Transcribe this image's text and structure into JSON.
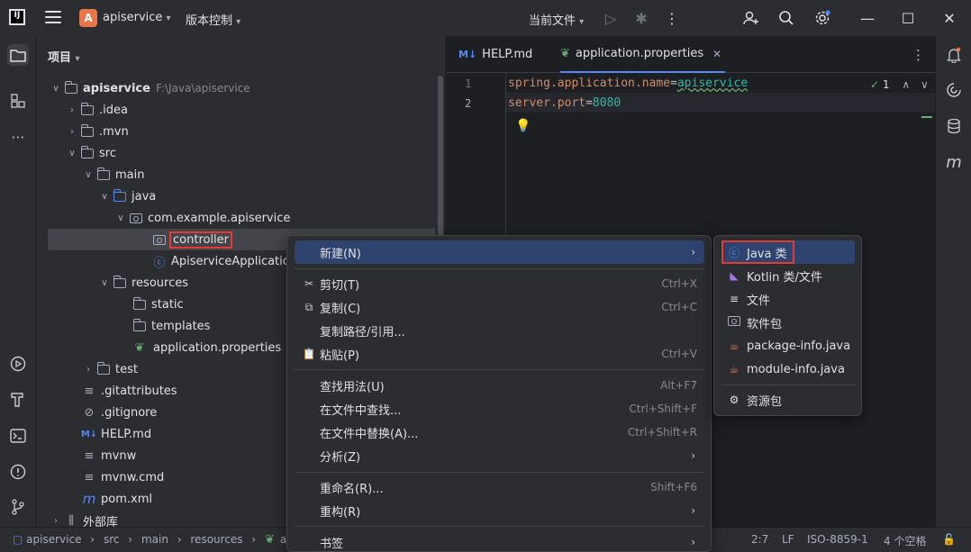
{
  "titlebar": {
    "logo": "IJ",
    "project_badge": "A",
    "project_name": "apiservice",
    "vcs_label": "版本控制",
    "run_config": "当前文件"
  },
  "project_panel": {
    "header": "项目",
    "root_name": "apiservice",
    "root_path": "F:\\Java\\apiservice",
    "items": [
      {
        "label": ".idea"
      },
      {
        "label": ".mvn"
      },
      {
        "label": "src"
      },
      {
        "label": "main"
      },
      {
        "label": "java"
      },
      {
        "label": "com.example.apiservice"
      },
      {
        "label": "controller"
      },
      {
        "label": "ApiserviceApplication"
      },
      {
        "label": "resources"
      },
      {
        "label": "static"
      },
      {
        "label": "templates"
      },
      {
        "label": "application.properties"
      },
      {
        "label": "test"
      },
      {
        "label": ".gitattributes"
      },
      {
        "label": ".gitignore"
      },
      {
        "label": "HELP.md"
      },
      {
        "label": "mvnw"
      },
      {
        "label": "mvnw.cmd"
      },
      {
        "label": "pom.xml"
      },
      {
        "label": "外部库"
      }
    ]
  },
  "editor": {
    "tabs": [
      {
        "label": "HELP.md",
        "badge": "M↓"
      },
      {
        "label": "application.properties"
      }
    ],
    "lines": [
      {
        "num": "1",
        "key": "spring.application.name",
        "eq": "=",
        "value": "apiservice"
      },
      {
        "num": "2",
        "key": "server.port",
        "eq": "=",
        "value": "8080"
      }
    ],
    "inspection_count": "1"
  },
  "context_menu": {
    "items": [
      {
        "label": "新建(N)",
        "shortcut": ""
      },
      {
        "label": "剪切(T)",
        "shortcut": "Ctrl+X"
      },
      {
        "label": "复制(C)",
        "shortcut": "Ctrl+C"
      },
      {
        "label": "复制路径/引用...",
        "shortcut": ""
      },
      {
        "label": "粘贴(P)",
        "shortcut": "Ctrl+V"
      },
      {
        "label": "查找用法(U)",
        "shortcut": "Alt+F7"
      },
      {
        "label": "在文件中查找...",
        "shortcut": "Ctrl+Shift+F"
      },
      {
        "label": "在文件中替换(A)...",
        "shortcut": "Ctrl+Shift+R"
      },
      {
        "label": "分析(Z)",
        "shortcut": ""
      },
      {
        "label": "重命名(R)...",
        "shortcut": "Shift+F6"
      },
      {
        "label": "重构(R)",
        "shortcut": ""
      },
      {
        "label": "书签",
        "shortcut": ""
      }
    ]
  },
  "submenu": {
    "items": [
      {
        "label": "Java 类"
      },
      {
        "label": "Kotlin 类/文件"
      },
      {
        "label": "文件"
      },
      {
        "label": "软件包"
      },
      {
        "label": "package-info.java"
      },
      {
        "label": "module-info.java"
      },
      {
        "label": "资源包"
      }
    ]
  },
  "statusbar": {
    "breadcrumbs": [
      "apiservice",
      "src",
      "main",
      "resources",
      "ap"
    ],
    "position": "2:7",
    "line_sep": "LF",
    "encoding": "ISO-8859-1",
    "indent": "4 个空格"
  },
  "colors": {
    "accent": "#548af7",
    "highlight_box": "#e53935",
    "menu_hover": "#2e436e"
  }
}
